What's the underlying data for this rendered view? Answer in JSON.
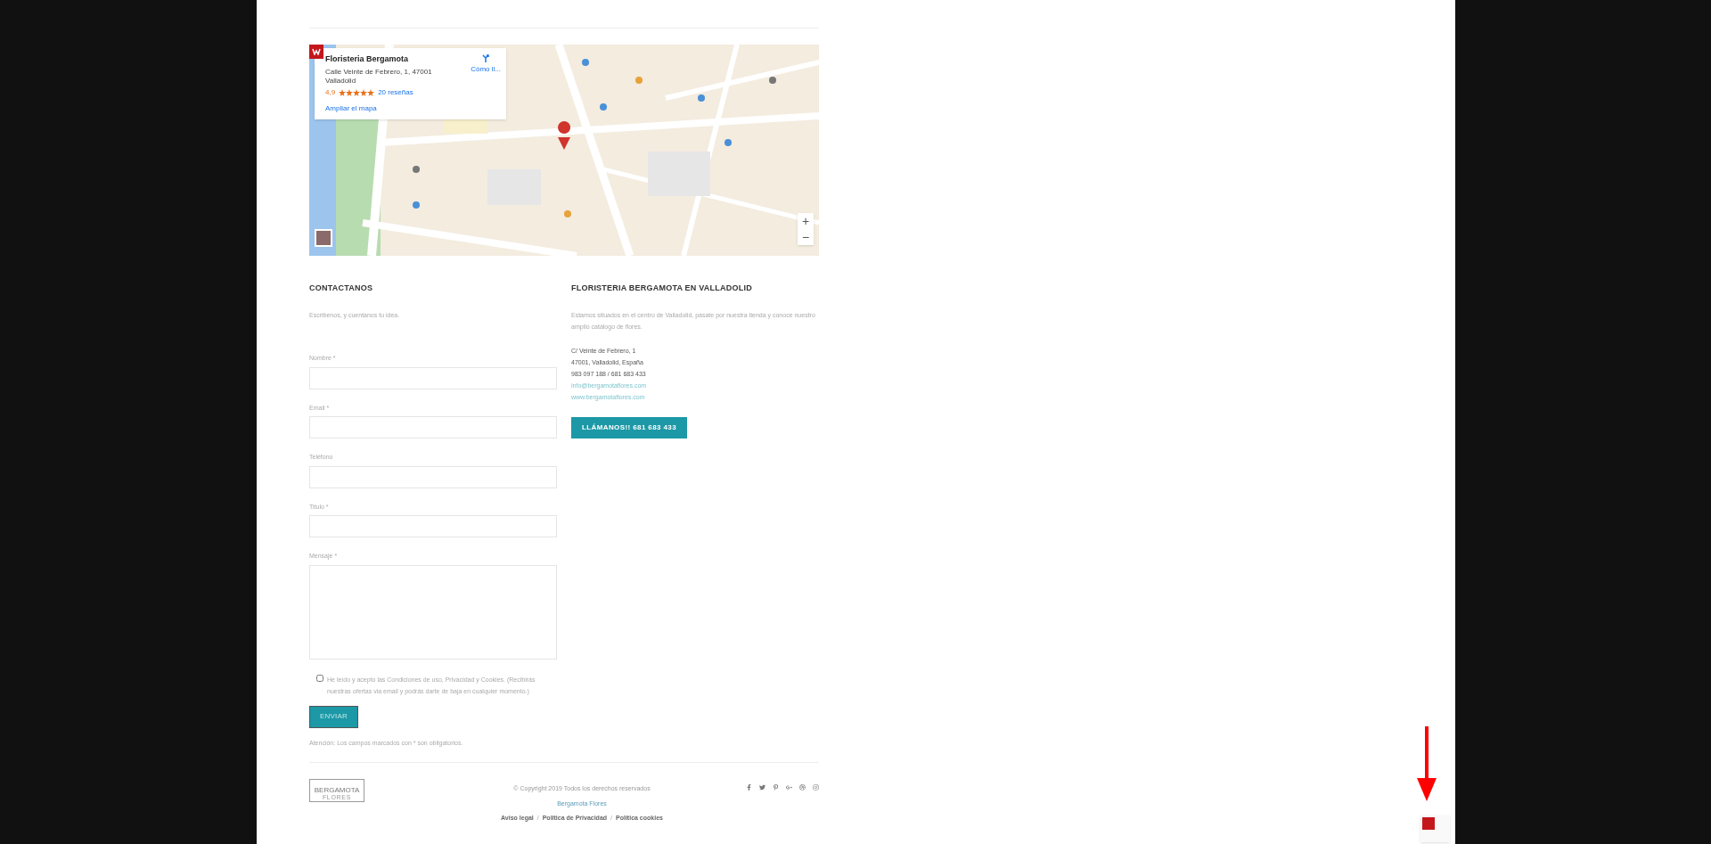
{
  "map": {
    "place_card": {
      "title": "Floristeria Bergamota",
      "address": "Calle Veinte de Febrero, 1, 47001 Valladolid",
      "rating": "4,9",
      "stars": 5,
      "reviews": "20 reseñas",
      "enlarge_link": "Ampliar el mapa",
      "directions": "Cómo ll..."
    },
    "zoom_in": "+",
    "zoom_out": "−"
  },
  "contact": {
    "title": "CONTACTANOS",
    "intro": "Escribenos, y cuentanos tu idea.",
    "fields": [
      {
        "label": "Nombre *",
        "kind": "input"
      },
      {
        "label": "Email *",
        "kind": "input"
      },
      {
        "label": "Teléfono",
        "kind": "input"
      },
      {
        "label": "Titulo *",
        "kind": "input"
      },
      {
        "label": "Mensaje *",
        "kind": "textarea"
      }
    ],
    "consent": {
      "text": "He leído y acepto las Condiciones de uso, Privacidad y Cookies. (Recibirás nuestras ofertas via email y podrás darte de baja en cualquier momento.)",
      "checked": false
    },
    "submit": "ENVIAR",
    "note": "Atención: Los campos marcados con * son obligatorios."
  },
  "store": {
    "title": "FLORISTERIA BERGAMOTA EN VALLADOLID",
    "intro": "Estamos situados en el centro de Valladolid, pásate por nuestra tienda y conoce nuestro amplio catálogo de flores.",
    "address_lines": [
      "C/ Veinte de Febrero, 1",
      "47001, Valladolid, España",
      "983 097 188 / 681 683 433"
    ],
    "links": [
      "info@bergamotaflores.com",
      "www.bergamotaflores.com"
    ],
    "call_button": "LLÁMANOS!! 681 683 433"
  },
  "footer": {
    "logo": "BERGAMOTA",
    "logo_sub": "FLORES",
    "copyright": "© Copyright 2019 Todos los derechos reservados",
    "brand_link": "Bergamota Flores",
    "legal_links": [
      {
        "label": "Aviso legal"
      },
      {
        "label": "Politica de Privacidad"
      },
      {
        "label": "Politica cookies"
      }
    ],
    "separator": "/"
  }
}
